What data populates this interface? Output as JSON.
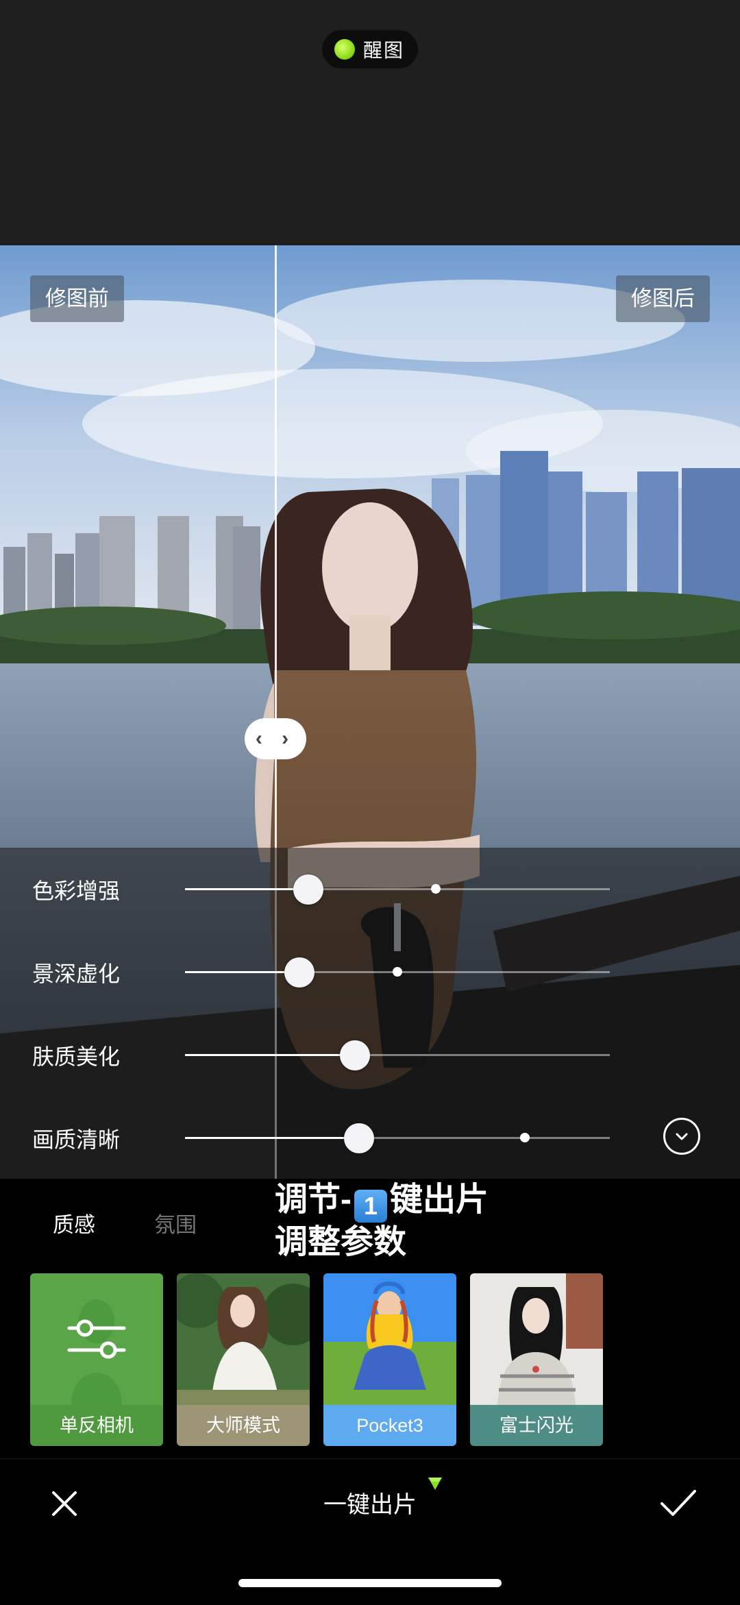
{
  "top": {
    "app_badge": "醒图"
  },
  "compare": {
    "before_label": "修图前",
    "after_label": "修图后",
    "handle_glyph": "‹ ›"
  },
  "sliders": [
    {
      "label": "色彩增强",
      "value": 0.29,
      "default": 0.59
    },
    {
      "label": "景深虚化",
      "value": 0.27,
      "default": 0.5
    },
    {
      "label": "肤质美化",
      "value": 0.4,
      "default": null
    },
    {
      "label": "画质清晰",
      "value": 0.41,
      "default": 0.8
    }
  ],
  "tabs": {
    "active": "质感",
    "inactive": "氛围"
  },
  "overlay_text": {
    "line1_a": "调节-",
    "line1_key": "1",
    "line1_b": "键出片",
    "line2": "调整参数"
  },
  "presets": [
    {
      "label": "单反相机",
      "color": "#4f9a3e",
      "selected": true
    },
    {
      "label": "大师模式",
      "color": "#9e9476",
      "selected": false
    },
    {
      "label": "Pocket3",
      "color": "#5daaf0",
      "selected": false
    },
    {
      "label": "富士闪光",
      "color": "#4e8c86",
      "selected": false
    }
  ],
  "bottom_bar": {
    "title": "一键出片",
    "cancel_icon": "close-icon",
    "confirm_icon": "check-icon"
  }
}
